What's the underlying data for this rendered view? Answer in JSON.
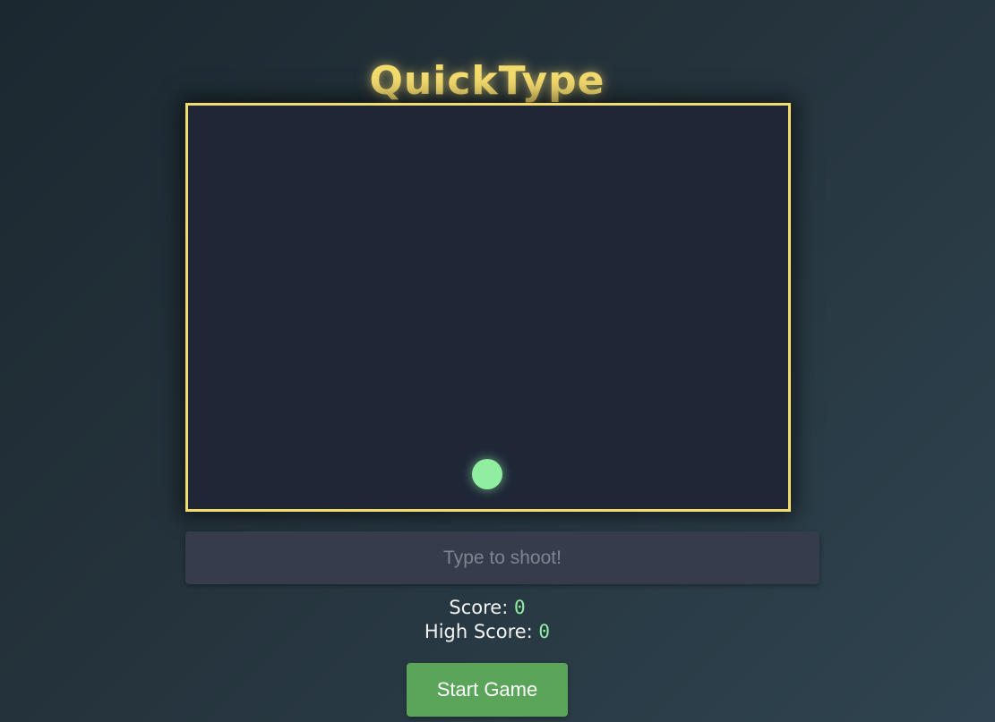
{
  "app": {
    "title": "QuickType"
  },
  "input": {
    "placeholder": "Type to shoot!",
    "value": ""
  },
  "stats": {
    "score_label": "Score: ",
    "score_value": "0",
    "high_score_label": "High Score: ",
    "high_score_value": "0"
  },
  "controls": {
    "start_label": "Start Game"
  },
  "colors": {
    "accent": "#f4db6e",
    "player": "#90eea0",
    "canvas_bg": "#1f2737",
    "button": "#5aa55a"
  }
}
